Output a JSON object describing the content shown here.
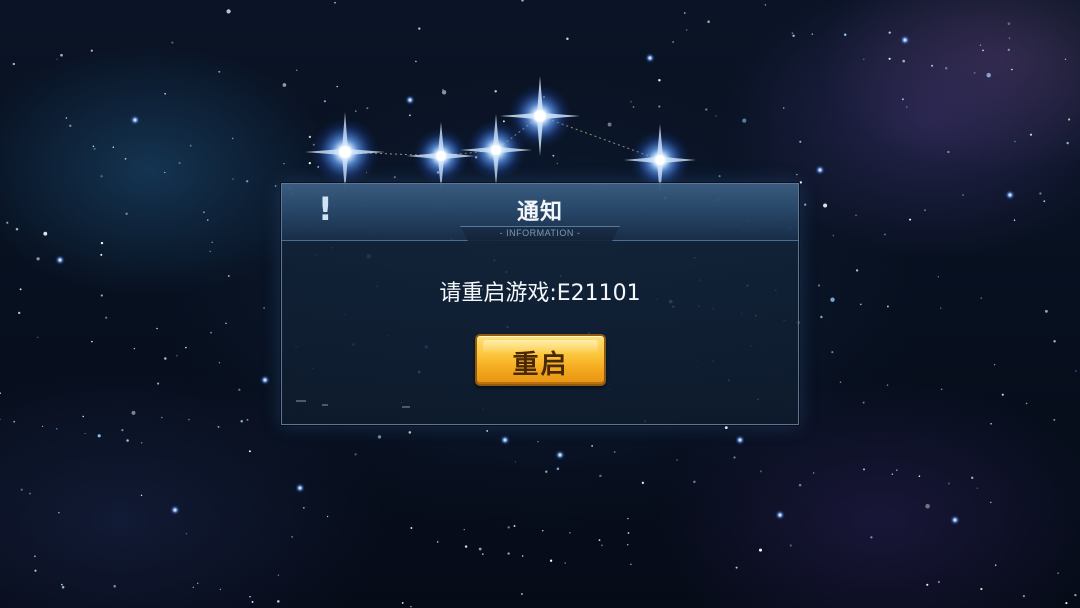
{
  "dialog": {
    "title": "通知",
    "subtitle": "- INFORMATION -",
    "alert_icon": "exclamation-icon",
    "message": "请重启游戏:E21101",
    "button_label": "重启"
  },
  "colors": {
    "background": "#07101f",
    "dialog_panel": "#14263c",
    "header": "#466e96",
    "button_gold": "#fcc53a",
    "button_text": "#4a2804",
    "title_text": "#f2f6fa"
  }
}
